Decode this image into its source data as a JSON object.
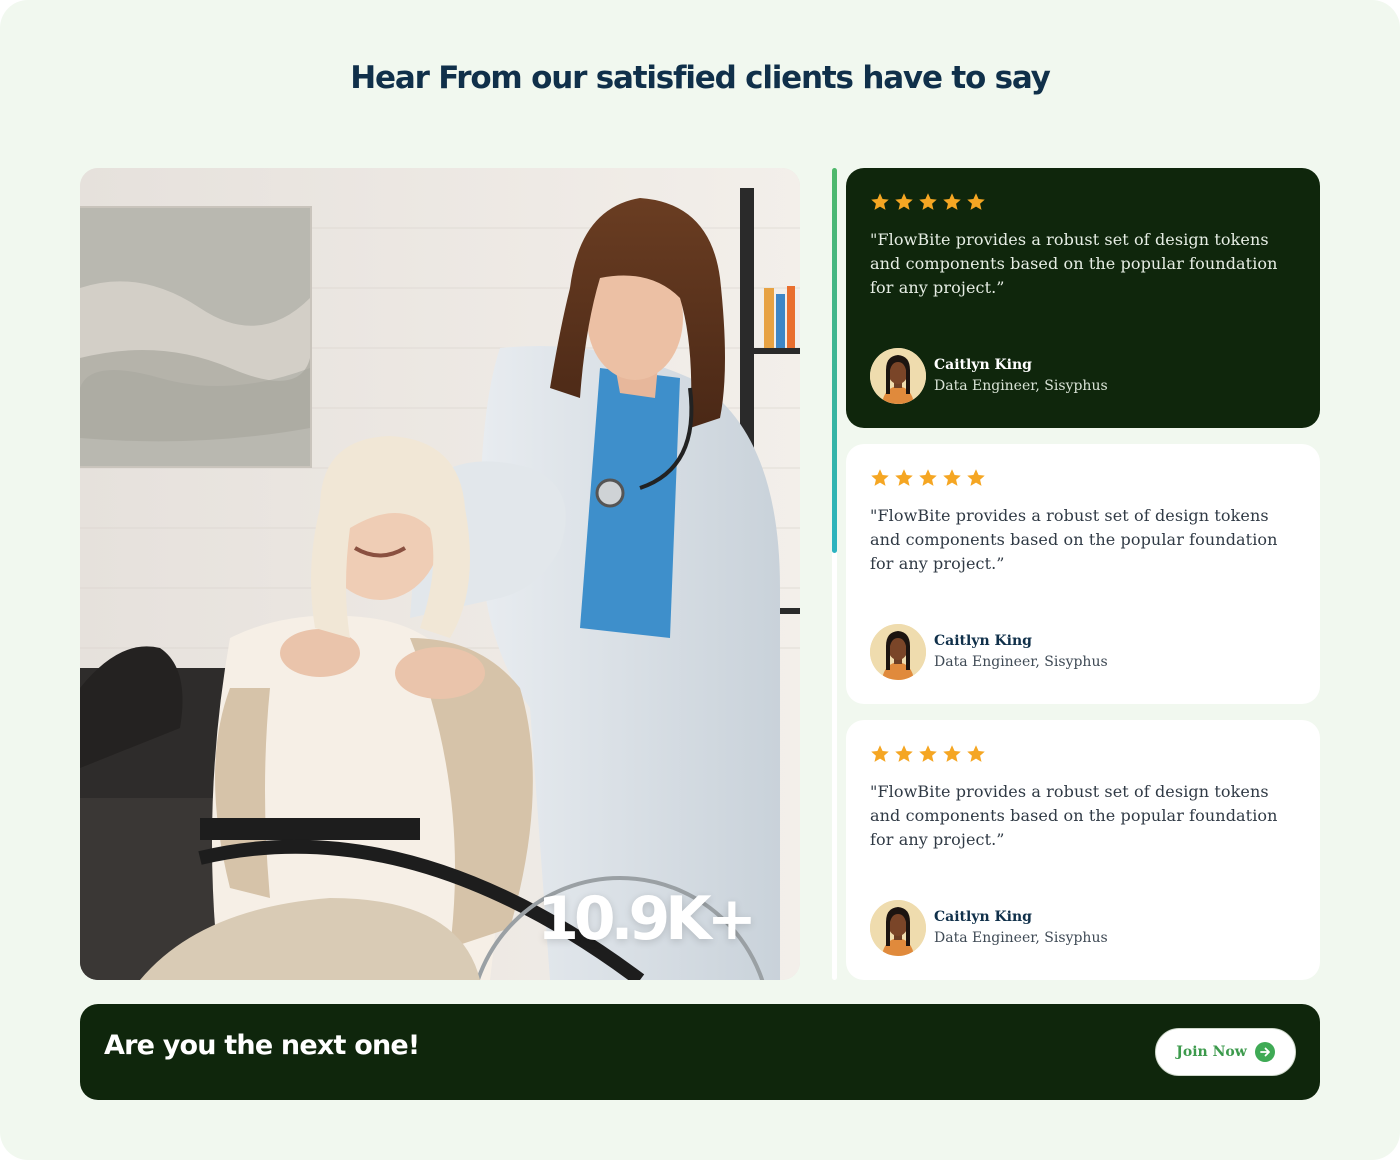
{
  "section": {
    "title": "Hear From our satisfied clients have to say"
  },
  "hero": {
    "image_icon": "caregiver-with-elderly-patient-photo",
    "stat": "10.9K+"
  },
  "testimonials": [
    {
      "rating": 5,
      "quote": "\"FlowBite provides a robust set of design tokens and components based on the popular foundation for any project.”",
      "name": "Caitlyn King",
      "role": "Data Engineer, Sisyphus",
      "theme": "dark"
    },
    {
      "rating": 5,
      "quote": "\"FlowBite provides a robust set of design tokens and components based on the popular foundation for any project.”",
      "name": "Caitlyn King",
      "role": "Data Engineer, Sisyphus",
      "theme": "light"
    },
    {
      "rating": 5,
      "quote": "\"FlowBite provides a robust set of design tokens and components based on the popular foundation for any project.”",
      "name": "Caitlyn King",
      "role": "Data Engineer, Sisyphus",
      "theme": "light"
    }
  ],
  "cta": {
    "text": "Are you the next one!",
    "button_label": "Join Now",
    "button_icon": "arrow-right-circle-icon"
  },
  "colors": {
    "page_bg": "#f1f8ef",
    "dark_green": "#0f260c",
    "title": "#10304a",
    "star": "#f5a623",
    "accent_green": "#3faa55"
  }
}
